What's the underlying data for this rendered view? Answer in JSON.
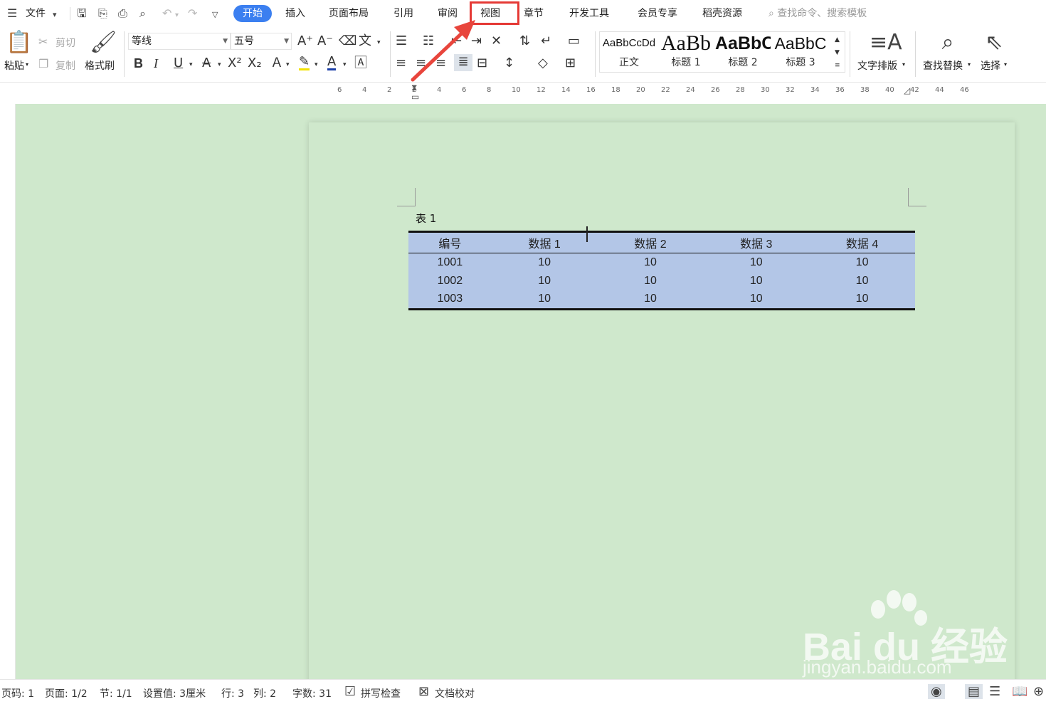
{
  "menu": {
    "file": "文件",
    "tabs": [
      "开始",
      "插入",
      "页面布局",
      "引用",
      "审阅",
      "视图",
      "章节",
      "开发工具",
      "会员专享",
      "稻壳资源"
    ],
    "active_tab": "开始",
    "highlighted_tab": "视图",
    "search_placeholder": "查找命令、搜索模板"
  },
  "ribbon": {
    "paste": "粘贴",
    "cut": "剪切",
    "copy": "复制",
    "format_painter": "格式刷",
    "font_name": "等线",
    "font_size": "五号",
    "styles": [
      {
        "preview": "AaBbCcDd",
        "name": "正文"
      },
      {
        "preview": "AaBb",
        "name": "标题 1"
      },
      {
        "preview": "AaBbC",
        "name": "标题 2"
      },
      {
        "preview": "AaBbC",
        "name": "标题 3"
      }
    ],
    "text_layout": "文字排版",
    "find_replace": "查找替换",
    "select": "选择"
  },
  "ruler": {
    "ticks": [
      "6",
      "4",
      "2",
      "2",
      "4",
      "6",
      "8",
      "10",
      "12",
      "14",
      "16",
      "18",
      "20",
      "22",
      "24",
      "26",
      "28",
      "30",
      "32",
      "34",
      "36",
      "38",
      "40",
      "42",
      "44",
      "46"
    ]
  },
  "document": {
    "caption": "表 1",
    "table": {
      "headers": [
        "编号",
        "数据 1",
        "数据 2",
        "数据 3",
        "数据 4"
      ],
      "rows": [
        [
          "1001",
          "10",
          "10",
          "10",
          "10"
        ],
        [
          "1002",
          "10",
          "10",
          "10",
          "10"
        ],
        [
          "1003",
          "10",
          "10",
          "10",
          "10"
        ]
      ]
    }
  },
  "watermark": {
    "brand": "Bai du 经验",
    "url": "jingyan.baidu.com"
  },
  "status": {
    "page_code": "页码: 1",
    "page": "页面: 1/2",
    "section": "节: 1/1",
    "setting": "设置值: 3厘米",
    "row": "行: 3",
    "col": "列: 2",
    "word_count": "字数: 31",
    "spell_check": "拼写检查",
    "doc_proof": "文档校对"
  },
  "colors": {
    "accent": "#3b7ff0",
    "highlight_box": "#e53935",
    "canvas_bg": "#cfe8cc",
    "table_fill": "#b3c6e7"
  }
}
